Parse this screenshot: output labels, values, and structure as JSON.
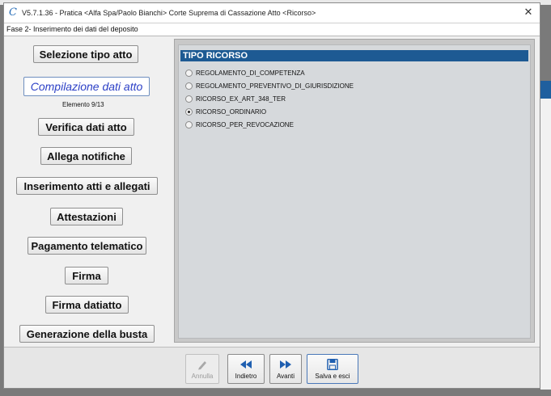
{
  "titlebar": {
    "title": "V5.7.1.36 - Pratica <Alfa Spa/Paolo Bianchi>   Corte Suprema di Cassazione  Atto <Ricorso>",
    "close_symbol": "✕"
  },
  "phase": {
    "label": "Fase 2- Inserimento dei dati del deposito"
  },
  "sidebar": {
    "items": [
      {
        "label": "Selezione tipo atto"
      },
      {
        "label": "Compilazione dati atto"
      },
      {
        "label": "Verifica dati atto"
      },
      {
        "label": "Allega notifiche"
      },
      {
        "label": "Inserimento atti e allegati"
      },
      {
        "label": "Attestazioni"
      },
      {
        "label": "Pagamento telematico"
      },
      {
        "label": "Firma"
      },
      {
        "label": "Firma datiatto"
      },
      {
        "label": "Generazione della busta"
      }
    ],
    "element_counter": "Elemento 9/13"
  },
  "form": {
    "section_title": "TIPO RICORSO",
    "options": [
      {
        "label": "REGOLAMENTO_DI_COMPETENZA",
        "checked": false
      },
      {
        "label": "REGOLAMENTO_PREVENTIVO_DI_GIURISDIZIONE",
        "checked": false
      },
      {
        "label": "RICORSO_EX_ART_348_TER",
        "checked": false
      },
      {
        "label": "RICORSO_ORDINARIO",
        "checked": true
      },
      {
        "label": "RICORSO_PER_REVOCAZIONE",
        "checked": false
      }
    ]
  },
  "toolbar": {
    "annulla": "Annulla",
    "indietro": "Indietro",
    "avanti": "Avanti",
    "salva": "Salva e esci"
  },
  "colors": {
    "accent": "#1d5a93",
    "active_text": "#2b3fc6",
    "icon_blue": "#1f5fb0"
  }
}
